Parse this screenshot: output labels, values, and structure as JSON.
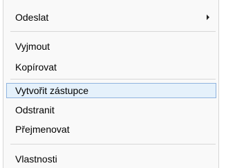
{
  "context_menu": {
    "items": [
      {
        "label": "Odeslat"
      },
      {
        "label": "Vyjmout"
      },
      {
        "label": "Kopírovat"
      },
      {
        "label": "Vytvořit zástupce"
      },
      {
        "label": "Odstranit"
      },
      {
        "label": "Přejmenovat"
      },
      {
        "label": "Vlastnosti"
      }
    ],
    "highlighted_item": "Vytvořit zástupce",
    "colors": {
      "menu_background": "#f9f9f9",
      "highlight_background": "#e5f1fb",
      "highlight_border": "#8fb3df",
      "separator": "#d7d7d7"
    }
  }
}
